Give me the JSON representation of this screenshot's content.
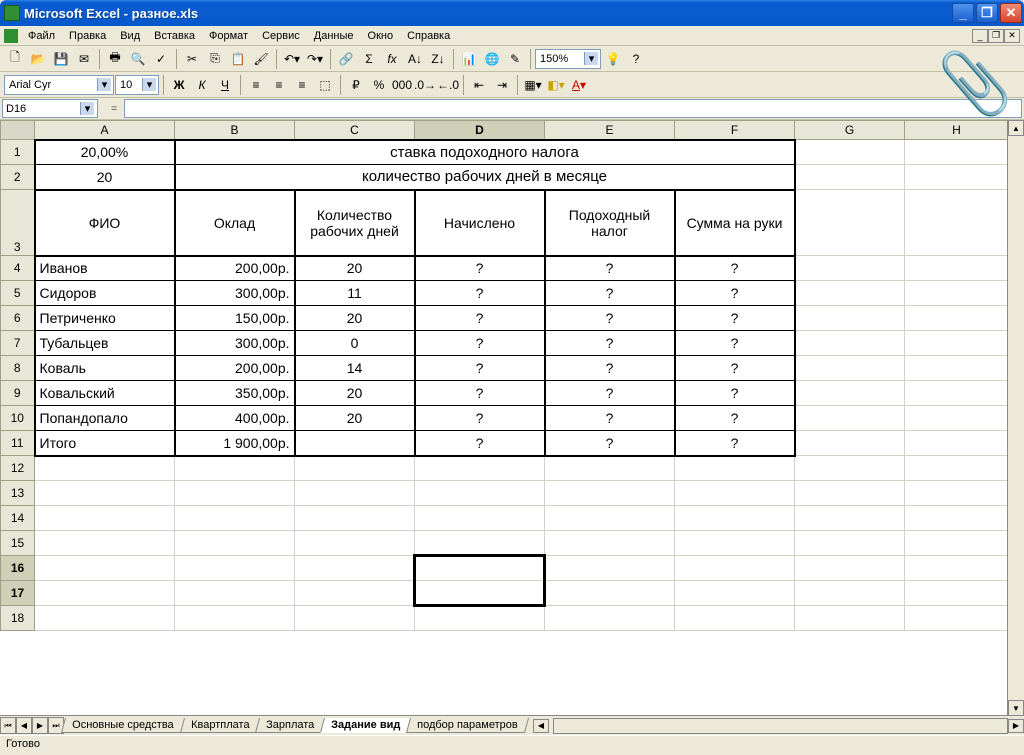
{
  "titlebar": {
    "app": "Microsoft Excel",
    "doc": "разное.xls"
  },
  "menu": {
    "file": "Файл",
    "edit": "Правка",
    "view": "Вид",
    "insert": "Вставка",
    "format": "Формат",
    "tools": "Сервис",
    "data": "Данные",
    "window": "Окно",
    "help": "Справка"
  },
  "toolbar": {
    "zoom": "150%",
    "help_qm": "?"
  },
  "format_bar": {
    "font": "Arial Cyr",
    "size": "10",
    "B": "Ж",
    "I": "К",
    "U": "Ч"
  },
  "namebox": {
    "ref": "D16"
  },
  "columns": [
    "A",
    "B",
    "C",
    "D",
    "E",
    "F",
    "G",
    "H"
  ],
  "tabs": {
    "t1": "Основные средства",
    "t2": "Квартплата",
    "t3": "Зарплата",
    "t4": "Задание вид",
    "t5": "подбор параметров"
  },
  "status": {
    "ready": "Готово"
  },
  "sheet": {
    "r1": {
      "a": "20,00%",
      "merged": "ставка подоходного налога"
    },
    "r2": {
      "a": "20",
      "merged": "количество рабочих дней в месяце"
    },
    "hdr": {
      "a": "ФИО",
      "b": "Оклад",
      "c": "Количество рабочих дней",
      "d": "Начислено",
      "e": "Подоходный налог",
      "f": "Сумма на руки"
    },
    "rows": [
      {
        "a": "Иванов",
        "b": "200,00р.",
        "c": "20",
        "d": "?",
        "e": "?",
        "f": "?"
      },
      {
        "a": "Сидоров",
        "b": "300,00р.",
        "c": "11",
        "d": "?",
        "e": "?",
        "f": "?"
      },
      {
        "a": "Петриченко",
        "b": "150,00р.",
        "c": "20",
        "d": "?",
        "e": "?",
        "f": "?"
      },
      {
        "a": "Тубальцев",
        "b": "300,00р.",
        "c": "0",
        "d": "?",
        "e": "?",
        "f": "?"
      },
      {
        "a": "Коваль",
        "b": "200,00р.",
        "c": "14",
        "d": "?",
        "e": "?",
        "f": "?"
      },
      {
        "a": "Ковальский",
        "b": "350,00р.",
        "c": "20",
        "d": "?",
        "e": "?",
        "f": "?"
      },
      {
        "a": "Попандопало",
        "b": "400,00р.",
        "c": "20",
        "d": "?",
        "e": "?",
        "f": "?"
      },
      {
        "a": "Итого",
        "b": "1 900,00р.",
        "c": "",
        "d": "?",
        "e": "?",
        "f": "?"
      }
    ]
  },
  "chart_data": {
    "type": "table",
    "title": "Payroll worksheet",
    "tax_rate_percent": 20.0,
    "working_days_in_month": 20,
    "columns": [
      "ФИО",
      "Оклад",
      "Количество рабочих дней",
      "Начислено",
      "Подоходный налог",
      "Сумма на руки"
    ],
    "rows": [
      {
        "name": "Иванов",
        "salary_rub": 200.0,
        "days": 20,
        "accrued": null,
        "tax": null,
        "net": null
      },
      {
        "name": "Сидоров",
        "salary_rub": 300.0,
        "days": 11,
        "accrued": null,
        "tax": null,
        "net": null
      },
      {
        "name": "Петриченко",
        "salary_rub": 150.0,
        "days": 20,
        "accrued": null,
        "tax": null,
        "net": null
      },
      {
        "name": "Тубальцев",
        "salary_rub": 300.0,
        "days": 0,
        "accrued": null,
        "tax": null,
        "net": null
      },
      {
        "name": "Коваль",
        "salary_rub": 200.0,
        "days": 14,
        "accrued": null,
        "tax": null,
        "net": null
      },
      {
        "name": "Ковальский",
        "salary_rub": 350.0,
        "days": 20,
        "accrued": null,
        "tax": null,
        "net": null
      },
      {
        "name": "Попандопало",
        "salary_rub": 400.0,
        "days": 20,
        "accrued": null,
        "tax": null,
        "net": null
      }
    ],
    "totals": {
      "salary_rub": 1900.0,
      "accrued": null,
      "tax": null,
      "net": null
    }
  }
}
